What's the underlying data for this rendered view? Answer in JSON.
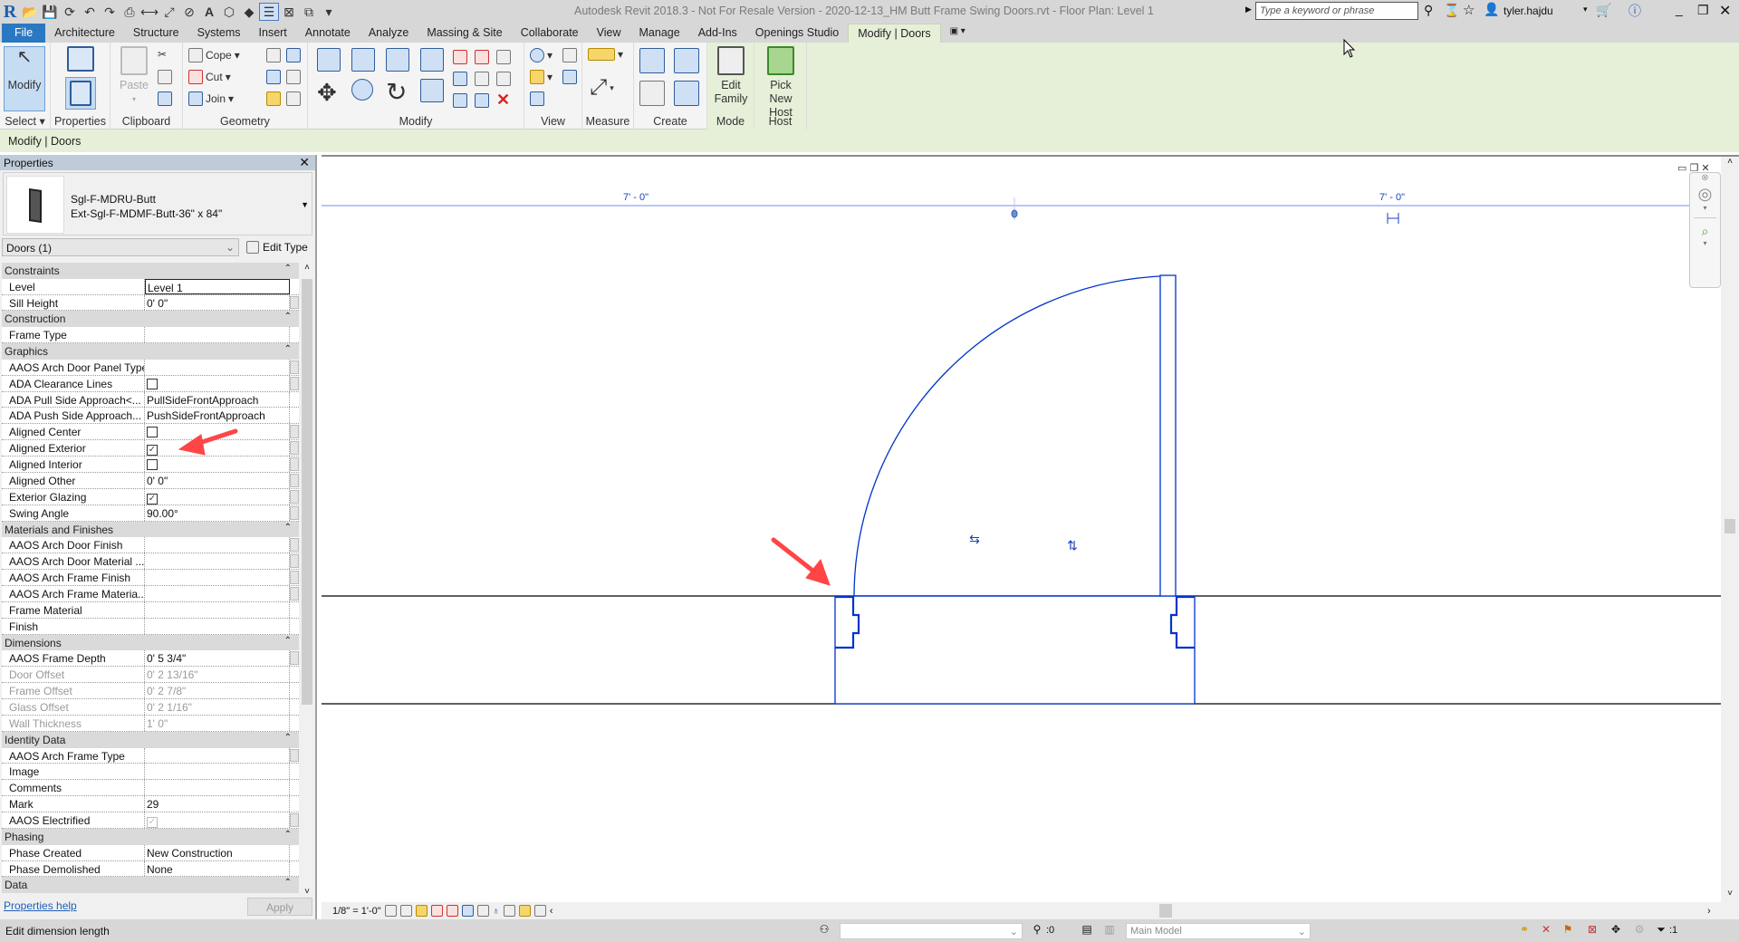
{
  "title_bar": {
    "app_title": "Autodesk Revit 2018.3 - Not For Resale Version -    2020-12-13_HM Butt Frame Swing Doors.rvt - Floor Plan: Level 1",
    "search_placeholder": "Type a keyword or phrase",
    "user": "tyler.hajdu"
  },
  "tabs": [
    "File",
    "Architecture",
    "Structure",
    "Systems",
    "Insert",
    "Annotate",
    "Analyze",
    "Massing & Site",
    "Collaborate",
    "View",
    "Manage",
    "Add-Ins",
    "Openings Studio",
    "Modify | Doors"
  ],
  "active_tab": "Modify | Doors",
  "ribbon": {
    "select": {
      "label": "Select",
      "modify": "Modify"
    },
    "properties": {
      "label": "Properties"
    },
    "clipboard": {
      "label": "Clipboard",
      "paste": "Paste"
    },
    "geometry": {
      "label": "Geometry",
      "cope": "Cope",
      "cut": "Cut",
      "join": "Join"
    },
    "modify": {
      "label": "Modify"
    },
    "view": {
      "label": "View"
    },
    "measure": {
      "label": "Measure"
    },
    "create": {
      "label": "Create"
    },
    "mode": {
      "label": "Mode",
      "edit_family_1": "Edit",
      "edit_family_2": "Family"
    },
    "host": {
      "label": "Host",
      "pick_1": "Pick",
      "pick_2": "New Host"
    }
  },
  "context_bar": "Modify | Doors",
  "properties": {
    "title": "Properties",
    "type_family": "Sgl-F-MDRU-Butt",
    "type_name": "Ext-Sgl-F-MDMF-Butt-36\" x 84\"",
    "selector": "Doors (1)",
    "edit_type": "Edit Type",
    "groups": [
      {
        "name": "Constraints",
        "rows": [
          {
            "name": "Level",
            "value": "Level 1",
            "editing": true
          },
          {
            "name": "Sill Height",
            "value": "0'  0\"",
            "btn": true
          }
        ]
      },
      {
        "name": "Construction",
        "rows": [
          {
            "name": "Frame Type",
            "value": ""
          }
        ]
      },
      {
        "name": "Graphics",
        "rows": [
          {
            "name": "AAOS Arch Door Panel Type",
            "value": "",
            "btn": true
          },
          {
            "name": "ADA Clearance Lines",
            "checkbox": true,
            "checked": false,
            "btn": true
          },
          {
            "name": "ADA Pull Side Approach<...",
            "value": "PullSideFrontApproach"
          },
          {
            "name": "ADA Push Side Approach...",
            "value": "PushSideFrontApproach"
          },
          {
            "name": "Aligned Center",
            "checkbox": true,
            "checked": false,
            "btn": true
          },
          {
            "name": "Aligned Exterior",
            "checkbox": true,
            "checked": true,
            "btn": true
          },
          {
            "name": "Aligned Interior",
            "checkbox": true,
            "checked": false,
            "btn": true
          },
          {
            "name": "Aligned Other",
            "value": "0'  0\"",
            "btn": true
          },
          {
            "name": "Exterior Glazing",
            "checkbox": true,
            "checked": true,
            "btn": true
          },
          {
            "name": "Swing Angle",
            "value": "90.00°",
            "btn": true
          }
        ]
      },
      {
        "name": "Materials and Finishes",
        "rows": [
          {
            "name": "AAOS Arch Door Finish",
            "value": "",
            "btn": true
          },
          {
            "name": "AAOS Arch Door Material ...",
            "value": "",
            "btn": true
          },
          {
            "name": "AAOS Arch Frame Finish",
            "value": "",
            "btn": true
          },
          {
            "name": "AAOS Arch Frame Materia...",
            "value": "",
            "btn": true
          },
          {
            "name": "Frame Material",
            "value": ""
          },
          {
            "name": "Finish",
            "value": ""
          }
        ]
      },
      {
        "name": "Dimensions",
        "rows": [
          {
            "name": "AAOS Frame Depth",
            "value": "0'  5 3/4\"",
            "btn": true
          },
          {
            "name": "Door Offset",
            "value": "0'  2 13/16\"",
            "disabled": true
          },
          {
            "name": "Frame Offset",
            "value": "0'  2 7/8\"",
            "disabled": true
          },
          {
            "name": "Glass Offset",
            "value": "0'  2 1/16\"",
            "disabled": true
          },
          {
            "name": "Wall Thickness",
            "value": "1'  0\"",
            "disabled": true
          }
        ]
      },
      {
        "name": "Identity Data",
        "rows": [
          {
            "name": "AAOS Arch Frame Type",
            "value": "",
            "btn": true
          },
          {
            "name": "Image",
            "value": ""
          },
          {
            "name": "Comments",
            "value": ""
          },
          {
            "name": "Mark",
            "value": "29"
          },
          {
            "name": "AAOS Electrified",
            "checkbox": true,
            "checked": true,
            "cbdisabled": true,
            "btn": true
          }
        ]
      },
      {
        "name": "Phasing",
        "rows": [
          {
            "name": "Phase Created",
            "value": "New Construction"
          },
          {
            "name": "Phase Demolished",
            "value": "None"
          }
        ]
      },
      {
        "name": "Data",
        "rows": []
      }
    ],
    "help": "Properties help",
    "apply": "Apply"
  },
  "view": {
    "dimensions": [
      "7' - 0\"",
      "7' - 0\""
    ],
    "line_color": "#0033cc",
    "annotation_color": "#ff4040"
  },
  "view_bar": {
    "scale": "1/8\" = 1'-0\""
  },
  "status": {
    "message": "Edit dimension length",
    "editable_count": ":0",
    "model": "Main Model",
    "filter_count": ":1"
  }
}
